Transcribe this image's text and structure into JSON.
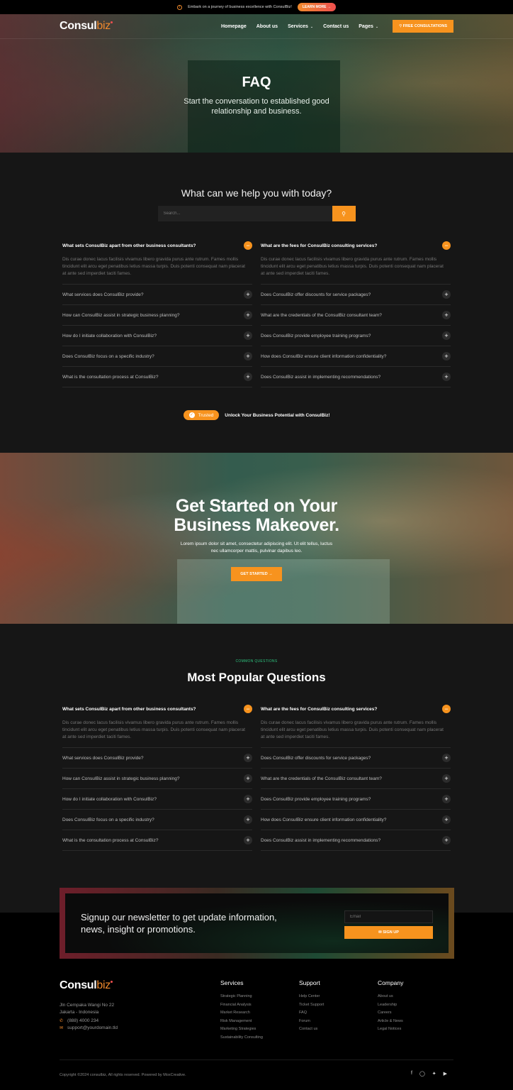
{
  "announcement": {
    "icon": "info-icon",
    "text": "Embark on a journey of business excellence with ConsulBiz!",
    "button": "LEARN MORE →"
  },
  "brand": {
    "name_main": "Consul",
    "name_accent": "biz"
  },
  "nav": {
    "items": [
      {
        "label": "Homepage",
        "dropdown": false
      },
      {
        "label": "About us",
        "dropdown": false
      },
      {
        "label": "Services",
        "dropdown": true
      },
      {
        "label": "Contact us",
        "dropdown": false
      },
      {
        "label": "Pages",
        "dropdown": true
      }
    ],
    "cta": "FREE CONSULTATIONS"
  },
  "hero": {
    "title": "FAQ",
    "subtitle_line1": "Start the conversation to established good",
    "subtitle_line2": "relationship and business."
  },
  "help": {
    "title": "What can we help you with today?",
    "search_placeholder": "Search..."
  },
  "faq": {
    "left": [
      {
        "q": "What sets ConsulBiz apart from other business consultants?",
        "open": true,
        "a": "Dis curae donec lacus facilisis vivamus libero gravida purus ante rutrum. Fames mollis tincidunt elit arcu eget penatibus letius massa turpis. Duis potenti consequat nam placerat at ante sed imperdiet taciti fames."
      },
      {
        "q": "What services does ConsulBiz provide?",
        "open": false
      },
      {
        "q": "How can ConsulBiz assist in strategic business planning?",
        "open": false
      },
      {
        "q": "How do I initiate collaboration with ConsulBiz?",
        "open": false
      },
      {
        "q": "Does ConsulBiz focus on a specific industry?",
        "open": false
      },
      {
        "q": "What is the consultation process at ConsulBiz?",
        "open": false
      }
    ],
    "right": [
      {
        "q": "What are the fees for ConsulBiz consulting services?",
        "open": true,
        "a": "Dis curae donec lacus facilisis vivamus libero gravida purus ante rutrum. Fames mollis tincidunt elit arcu eget penatibus letius massa turpis. Duis potenti consequat nam placerat at ante sed imperdiet taciti fames."
      },
      {
        "q": "Does ConsulBiz offer discounts for service packages?",
        "open": false
      },
      {
        "q": "What are the credentials of the ConsulBiz consultant team?",
        "open": false
      },
      {
        "q": "Does ConsulBiz provide employee training programs?",
        "open": false
      },
      {
        "q": "How does ConsulBiz ensure client information confidentiality?",
        "open": false
      },
      {
        "q": "Does ConsulBiz assist in implementing recommendations?",
        "open": false
      }
    ]
  },
  "trusted": {
    "badge": "Trusted",
    "text": "Unlock Your Business Potential with ConsulBiz!"
  },
  "cta_band": {
    "title_line1": "Get Started on Your",
    "title_line2": "Business Makeover.",
    "text_line1": "Lorem ipsum dolor sit amet, consectetur adipiscing elit. Ut elit tellus, luctus",
    "text_line2": "nec ullamcorper mattis, pulvinar dapibus leo.",
    "button": "GET STARTED →"
  },
  "popular": {
    "eyebrow": "COMMON QUESTIONS",
    "title": "Most Popular Questions"
  },
  "newsletter": {
    "title": "Signup our newsletter to get update information, news, insight or promotions.",
    "email_placeholder": "Email",
    "button": "SIGN UP"
  },
  "footer": {
    "address_line1": "Jln Cempaka Wangi No 22",
    "address_line2": "Jakarta - Indonesia",
    "phone": "(888) 4000 234",
    "email": "support@yourdomain.tld",
    "columns": [
      {
        "title": "Services",
        "links": [
          "Strategic Planning",
          "Financial Analysis",
          "Market Research",
          "Risk Management",
          "Marketing Strategies",
          "Sustainability Consulting"
        ]
      },
      {
        "title": "Support",
        "links": [
          "Help Center",
          "Ticket Support",
          "FAQ",
          "Forum",
          "Contact us"
        ]
      },
      {
        "title": "Company",
        "links": [
          "About us",
          "Leadership",
          "Careers",
          "Article & News",
          "Legal Notices"
        ]
      }
    ],
    "copyright": "Copyright ©2024 consulbiz, All rights reserved. Powered by MoxCreative.",
    "social": [
      "facebook-icon",
      "instagram-icon",
      "twitter-icon",
      "youtube-icon"
    ]
  },
  "colors": {
    "accent": "#f7931e",
    "eyebrow": "#2ec27e",
    "background": "#161616",
    "footer": "#000000"
  }
}
